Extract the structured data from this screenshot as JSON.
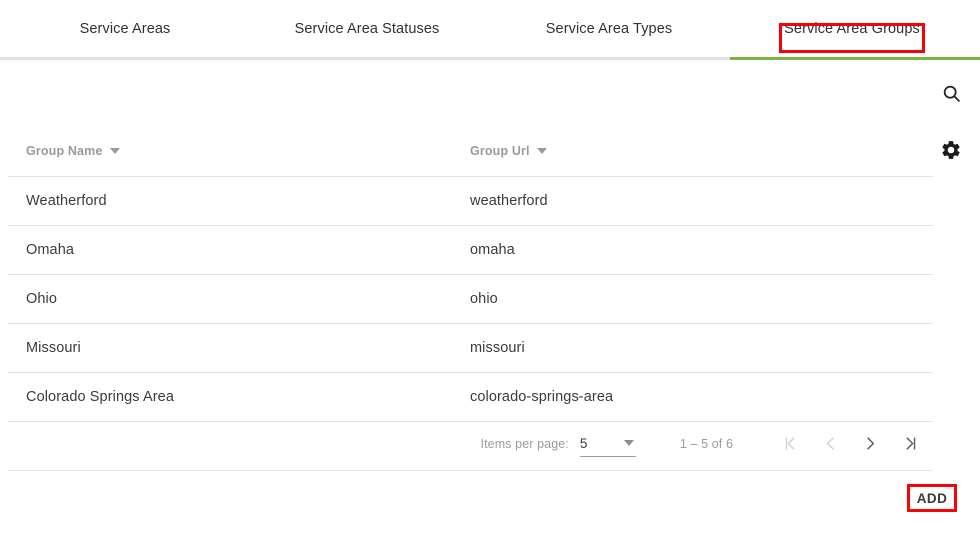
{
  "tabs": [
    {
      "label": "Service Areas",
      "active": false
    },
    {
      "label": "Service Area Statuses",
      "active": false
    },
    {
      "label": "Service Area Types",
      "active": false
    },
    {
      "label": "Service Area Groups",
      "active": true
    }
  ],
  "actions": {
    "search_icon": "search-icon",
    "settings_icon": "gear-icon"
  },
  "table": {
    "columns": [
      {
        "key": "group_name",
        "label": "Group Name",
        "sort_icon": "caret-down-icon"
      },
      {
        "key": "group_url",
        "label": "Group Url",
        "sort_icon": "caret-down-icon"
      }
    ],
    "rows": [
      {
        "group_name": "Weatherford",
        "group_url": "weatherford"
      },
      {
        "group_name": "Omaha",
        "group_url": "omaha"
      },
      {
        "group_name": "Ohio",
        "group_url": "ohio"
      },
      {
        "group_name": "Missouri",
        "group_url": "missouri"
      },
      {
        "group_name": "Colorado Springs Area",
        "group_url": "colorado-springs-area"
      }
    ]
  },
  "paginator": {
    "items_per_page_label": "Items per page:",
    "items_per_page_value": "5",
    "range_label": "1 – 5 of 6",
    "first_page_icon": "first-page-icon",
    "prev_page_icon": "previous-page-icon",
    "next_page_icon": "next-page-icon",
    "last_page_icon": "last-page-icon"
  },
  "footer": {
    "add_label": "ADD"
  },
  "colors": {
    "accent_green": "#7cb342",
    "highlight_red": "#fb0007",
    "divider": "#e1e1e1",
    "muted_text": "#9a9a9a",
    "body_text": "#3b3b3b",
    "disabled_arrow": "#d0d0d0",
    "enabled_arrow": "#616161"
  }
}
